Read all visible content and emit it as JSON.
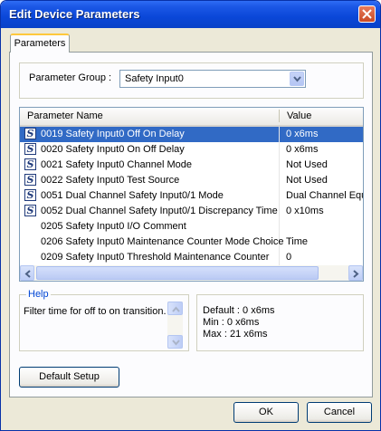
{
  "window": {
    "title": "Edit Device Parameters"
  },
  "tabs": [
    {
      "label": "Parameters"
    }
  ],
  "parameter_group": {
    "label": "Parameter Group :",
    "selected": "Safety Input0"
  },
  "table": {
    "columns": [
      "Parameter Name",
      "Value"
    ],
    "rows": [
      {
        "icon": "S",
        "name": "0019 Safety Input0 Off On Delay",
        "value": "0 x6ms",
        "selected": true
      },
      {
        "icon": "S",
        "name": "0020 Safety Input0 On Off Delay",
        "value": "0 x6ms"
      },
      {
        "icon": "S",
        "name": "0021 Safety Input0 Channel Mode",
        "value": "Not Used"
      },
      {
        "icon": "S",
        "name": "0022 Safety Input0 Test Source",
        "value": "Not Used"
      },
      {
        "icon": "S",
        "name": "0051 Dual Channel Safety Input0/1 Mode",
        "value": "Dual Channel Equ"
      },
      {
        "icon": "S",
        "name": "0052 Dual Channel Safety Input0/1 Discrepancy Time",
        "value": "0 x10ms"
      },
      {
        "icon": "",
        "name": "0205 Safety Input0 I/O Comment",
        "value": ""
      },
      {
        "icon": "",
        "name": "0206 Safety Input0 Maintenance Counter Mode Choice",
        "value": "Time"
      },
      {
        "icon": "",
        "name": "0209 Safety Input0 Threshold Maintenance Counter",
        "value": "0"
      }
    ]
  },
  "help": {
    "title": "Help",
    "text": "Filter time for off to on transition."
  },
  "info": {
    "default": "Default : 0 x6ms",
    "min": "Min : 0 x6ms",
    "max": "Max : 21 x6ms"
  },
  "buttons": {
    "default_setup": "Default Setup",
    "ok": "OK",
    "cancel": "Cancel"
  },
  "colors": {
    "title_bar": "#0a47d8",
    "selection": "#316ac5",
    "window_bg": "#ece9d8"
  }
}
